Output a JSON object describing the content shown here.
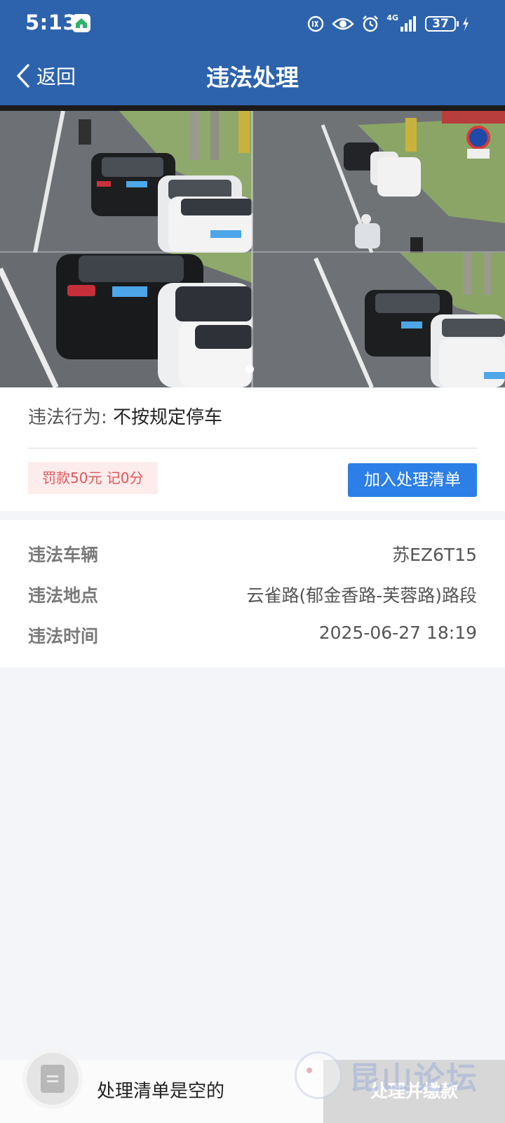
{
  "status_bar": {
    "time": "5:13",
    "network": "4G",
    "battery": "37"
  },
  "header": {
    "back_label": "返回",
    "title": "违法处理"
  },
  "violation": {
    "behavior_label": "违法行为:",
    "behavior_value": "不按规定停车",
    "penalty": "罚款50元 记0分",
    "add_button": "加入处理清单"
  },
  "details": {
    "rows": [
      {
        "label": "违法车辆",
        "value": "苏EZ6T15"
      },
      {
        "label": "违法地点",
        "value": "云雀路(郁金香路-芙蓉路)路段"
      },
      {
        "label": "违法时间",
        "value": "2025-06-27 18:19"
      }
    ]
  },
  "bottom": {
    "empty_text": "处理清单是空的",
    "pay_button": "处理并缴款"
  },
  "watermark": {
    "text": "昆山论坛"
  },
  "colors": {
    "header": "#2d63ad",
    "primary_button": "#2b7fe6",
    "penalty_text": "#e0565a",
    "penalty_bg": "#fdecec",
    "disabled_button": "#d7d7d7"
  },
  "icons": {
    "back": "chevron-left-icon",
    "app_badge": "home-icon",
    "cart": "list-icon"
  }
}
